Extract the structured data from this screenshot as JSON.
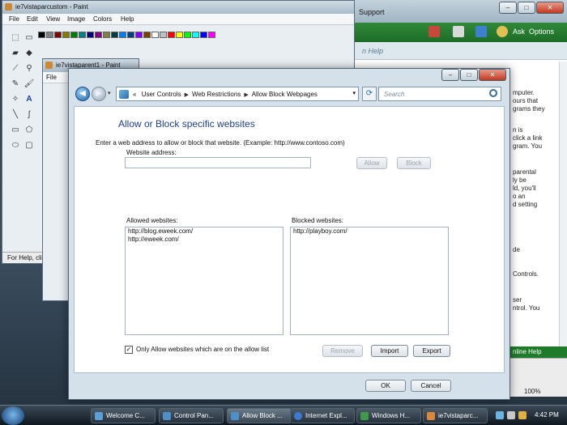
{
  "help_window": {
    "title": "Support",
    "ask": "Ask",
    "options": "Options",
    "search_placeholder": "n Help",
    "content_lines": [
      "mputer.",
      "ours that",
      "grams they",
      "n is",
      "click a link",
      "gram. You",
      "parental",
      "ly be",
      "ld, you'll",
      "o an",
      "d setting",
      "de",
      "Controls.",
      "ser",
      "ntrol. You"
    ],
    "footer": "nline Help",
    "zoom": "100%"
  },
  "paint_back": {
    "title": "ie7vistaparcustom - Paint",
    "menu": [
      "File",
      "Edit",
      "View",
      "Image",
      "Colors",
      "Help"
    ],
    "status": "For Help, click Help T"
  },
  "paint_front": {
    "title": "ie7vistaparent1 - Paint",
    "menu": [
      "File"
    ]
  },
  "palette_colors": [
    "#000000",
    "#808080",
    "#800000",
    "#808000",
    "#008000",
    "#008080",
    "#000080",
    "#800080",
    "#808040",
    "#004040",
    "#0080ff",
    "#004080",
    "#8000ff",
    "#804000",
    "#ffffff",
    "#c0c0c0",
    "#ff0000",
    "#ffff00",
    "#00ff00",
    "#00ffff",
    "#0000ff",
    "#ff00ff",
    "#ffff80",
    "#00ff80",
    "#80ffff",
    "#8080ff",
    "#ff0080",
    "#ff8040",
    "#ffffff",
    "#c0c0c0",
    "#ff8080",
    "#ffff40",
    "#80ff80",
    "#80ffff",
    "#8080c0",
    "#ff80c0",
    "#ffc080",
    "#e0e0e0",
    "#a0a0a0",
    "#404040",
    "#f0a0a0",
    "#a0f0f0"
  ],
  "dialog": {
    "breadcrumb": [
      "User Controls",
      "Web Restrictions",
      "Allow Block Webpages"
    ],
    "breadcrumb_prefix": "«",
    "search_placeholder": "Search",
    "heading": "Allow or Block specific websites",
    "instructions": "Enter a web address to allow or block that website.  (Example: http://www.contoso.com)",
    "website_address_label": "Website address:",
    "website_address_value": "",
    "allow_label": "Allow",
    "block_label": "Block",
    "allowed_label": "Allowed websites:",
    "blocked_label": "Blocked websites:",
    "allowed_sites": [
      "http://blog.eweek.com/",
      "http://eweek.com/"
    ],
    "blocked_sites": [
      "http://playboy.com/"
    ],
    "only_allow_label": "Only Allow websites which are on the allow list",
    "only_allow_checked": true,
    "remove_label": "Remove",
    "import_label": "Import",
    "export_label": "Export",
    "ok_label": "OK",
    "cancel_label": "Cancel"
  },
  "taskbar": {
    "buttons": [
      "Welcome C...",
      "Control Pan...",
      "Allow Block ...",
      "Internet Expl...",
      "Windows H...",
      "ie7vistaparc..."
    ],
    "clock": "4:42 PM"
  }
}
